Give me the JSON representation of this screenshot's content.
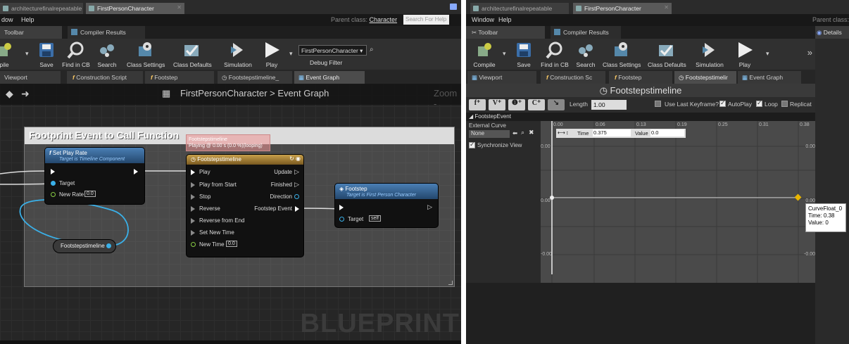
{
  "left": {
    "doc_tabs": [
      "architecturefinalrepeatable",
      "FirstPersonCharacter"
    ],
    "menu": [
      "dow",
      "Help"
    ],
    "parent_label": "Parent class:",
    "parent_value": "Character",
    "search_help": "Search For Help",
    "panel_tabs": [
      "Toolbar",
      "Compiler Results"
    ],
    "toolbar": [
      {
        "label": "pile",
        "icon": "compile-icon"
      },
      {
        "label": "Save",
        "icon": "save-icon"
      },
      {
        "label": "Find in CB",
        "icon": "find-in-cb-icon"
      },
      {
        "label": "Search",
        "icon": "search-icon"
      },
      {
        "label": "Class Settings",
        "icon": "class-settings-icon"
      },
      {
        "label": "Class Defaults",
        "icon": "class-defaults-icon"
      },
      {
        "label": "Simulation",
        "icon": "simulation-icon"
      },
      {
        "label": "Play",
        "icon": "play-icon"
      }
    ],
    "debug_select": "FirstPersonCharacter",
    "debug_filter": "Debug Filter",
    "editor_tabs": [
      "Viewport",
      "Construction Script",
      "Footstep",
      "Footstepstimeline_",
      "Event Graph"
    ],
    "breadcrumb": {
      "root": "FirstPersonCharacter",
      "sep": ">",
      "page": "Event Graph"
    },
    "zoom": "Zoom -",
    "comment": "Footprint Event to Call Function",
    "playing_label": {
      "line1": "Footstepstimeline",
      "line2": "Playing @ 0.00 s (0.0 %)(looping)"
    },
    "node_setplayrate": {
      "title": "Set Play Rate",
      "subtitle": "Target is Timeline Component",
      "target": "Target",
      "newrate": "New Rate",
      "newrate_val": "0.0"
    },
    "node_timeline": {
      "title": "Footstepstimeline",
      "inputs": [
        "Play",
        "Play from Start",
        "Stop",
        "Reverse",
        "Reverse from End",
        "Set New Time",
        "New Time"
      ],
      "newtime_val": "0.0",
      "outputs": [
        "Update",
        "Finished",
        "Direction",
        "Footstep Event"
      ]
    },
    "node_footstep": {
      "title": "Footstep",
      "subtitle": "Target is First Person Character",
      "target": "Target",
      "target_val": "self"
    },
    "var_node": "Footstepstimeline",
    "watermark": "BLUEPRINT"
  },
  "right": {
    "doc_tabs": [
      "architecturefinalrepeatable",
      "FirstPersonCharacter"
    ],
    "menu": [
      "Window",
      "Help"
    ],
    "parent_label": "Parent class:",
    "panel_tabs": [
      "Toolbar",
      "Compiler Results"
    ],
    "details": "Details",
    "toolbar": [
      {
        "label": "Compile",
        "icon": "compile-icon"
      },
      {
        "label": "Save",
        "icon": "save-icon"
      },
      {
        "label": "Find in CB",
        "icon": "find-in-cb-icon"
      },
      {
        "label": "Search",
        "icon": "search-icon"
      },
      {
        "label": "Class Settings",
        "icon": "class-settings-icon"
      },
      {
        "label": "Class Defaults",
        "icon": "class-defaults-icon"
      },
      {
        "label": "Simulation",
        "icon": "simulation-icon"
      },
      {
        "label": "Play",
        "icon": "play-icon"
      }
    ],
    "more": "»",
    "editor_tabs": [
      "Viewport",
      "Construction Sc",
      "Footstep",
      "Footstepstimelir",
      "Event Graph"
    ],
    "timeline_title": "Footstepstimeline",
    "length_label": "Length",
    "length_value": "1.00",
    "use_last_keyframe": "Use Last Keyframe?",
    "autoplay": "AutoPlay",
    "loop": "Loop",
    "replicated": "Replicat",
    "track_name": "FootstepEvent",
    "external_curve": "External Curve",
    "curve_select": "None",
    "synchronize_view": "Synchronize View",
    "time_label": "Time",
    "time_value": "0.375",
    "value_label": "Value",
    "value_value": "0.0",
    "time_ticks": [
      "0.00",
      "0.06",
      "0.13",
      "0.19",
      "0.25",
      "0.31",
      "0.38"
    ],
    "value_ticks_left": [
      "0.00",
      "0.00",
      "-0.00"
    ],
    "value_ticks_right": [
      "0.00",
      "0.00",
      "-0.00"
    ],
    "tooltip": {
      "name": "CurveFloat_0",
      "time": "Time: 0.38",
      "value": "Value: 0"
    }
  }
}
